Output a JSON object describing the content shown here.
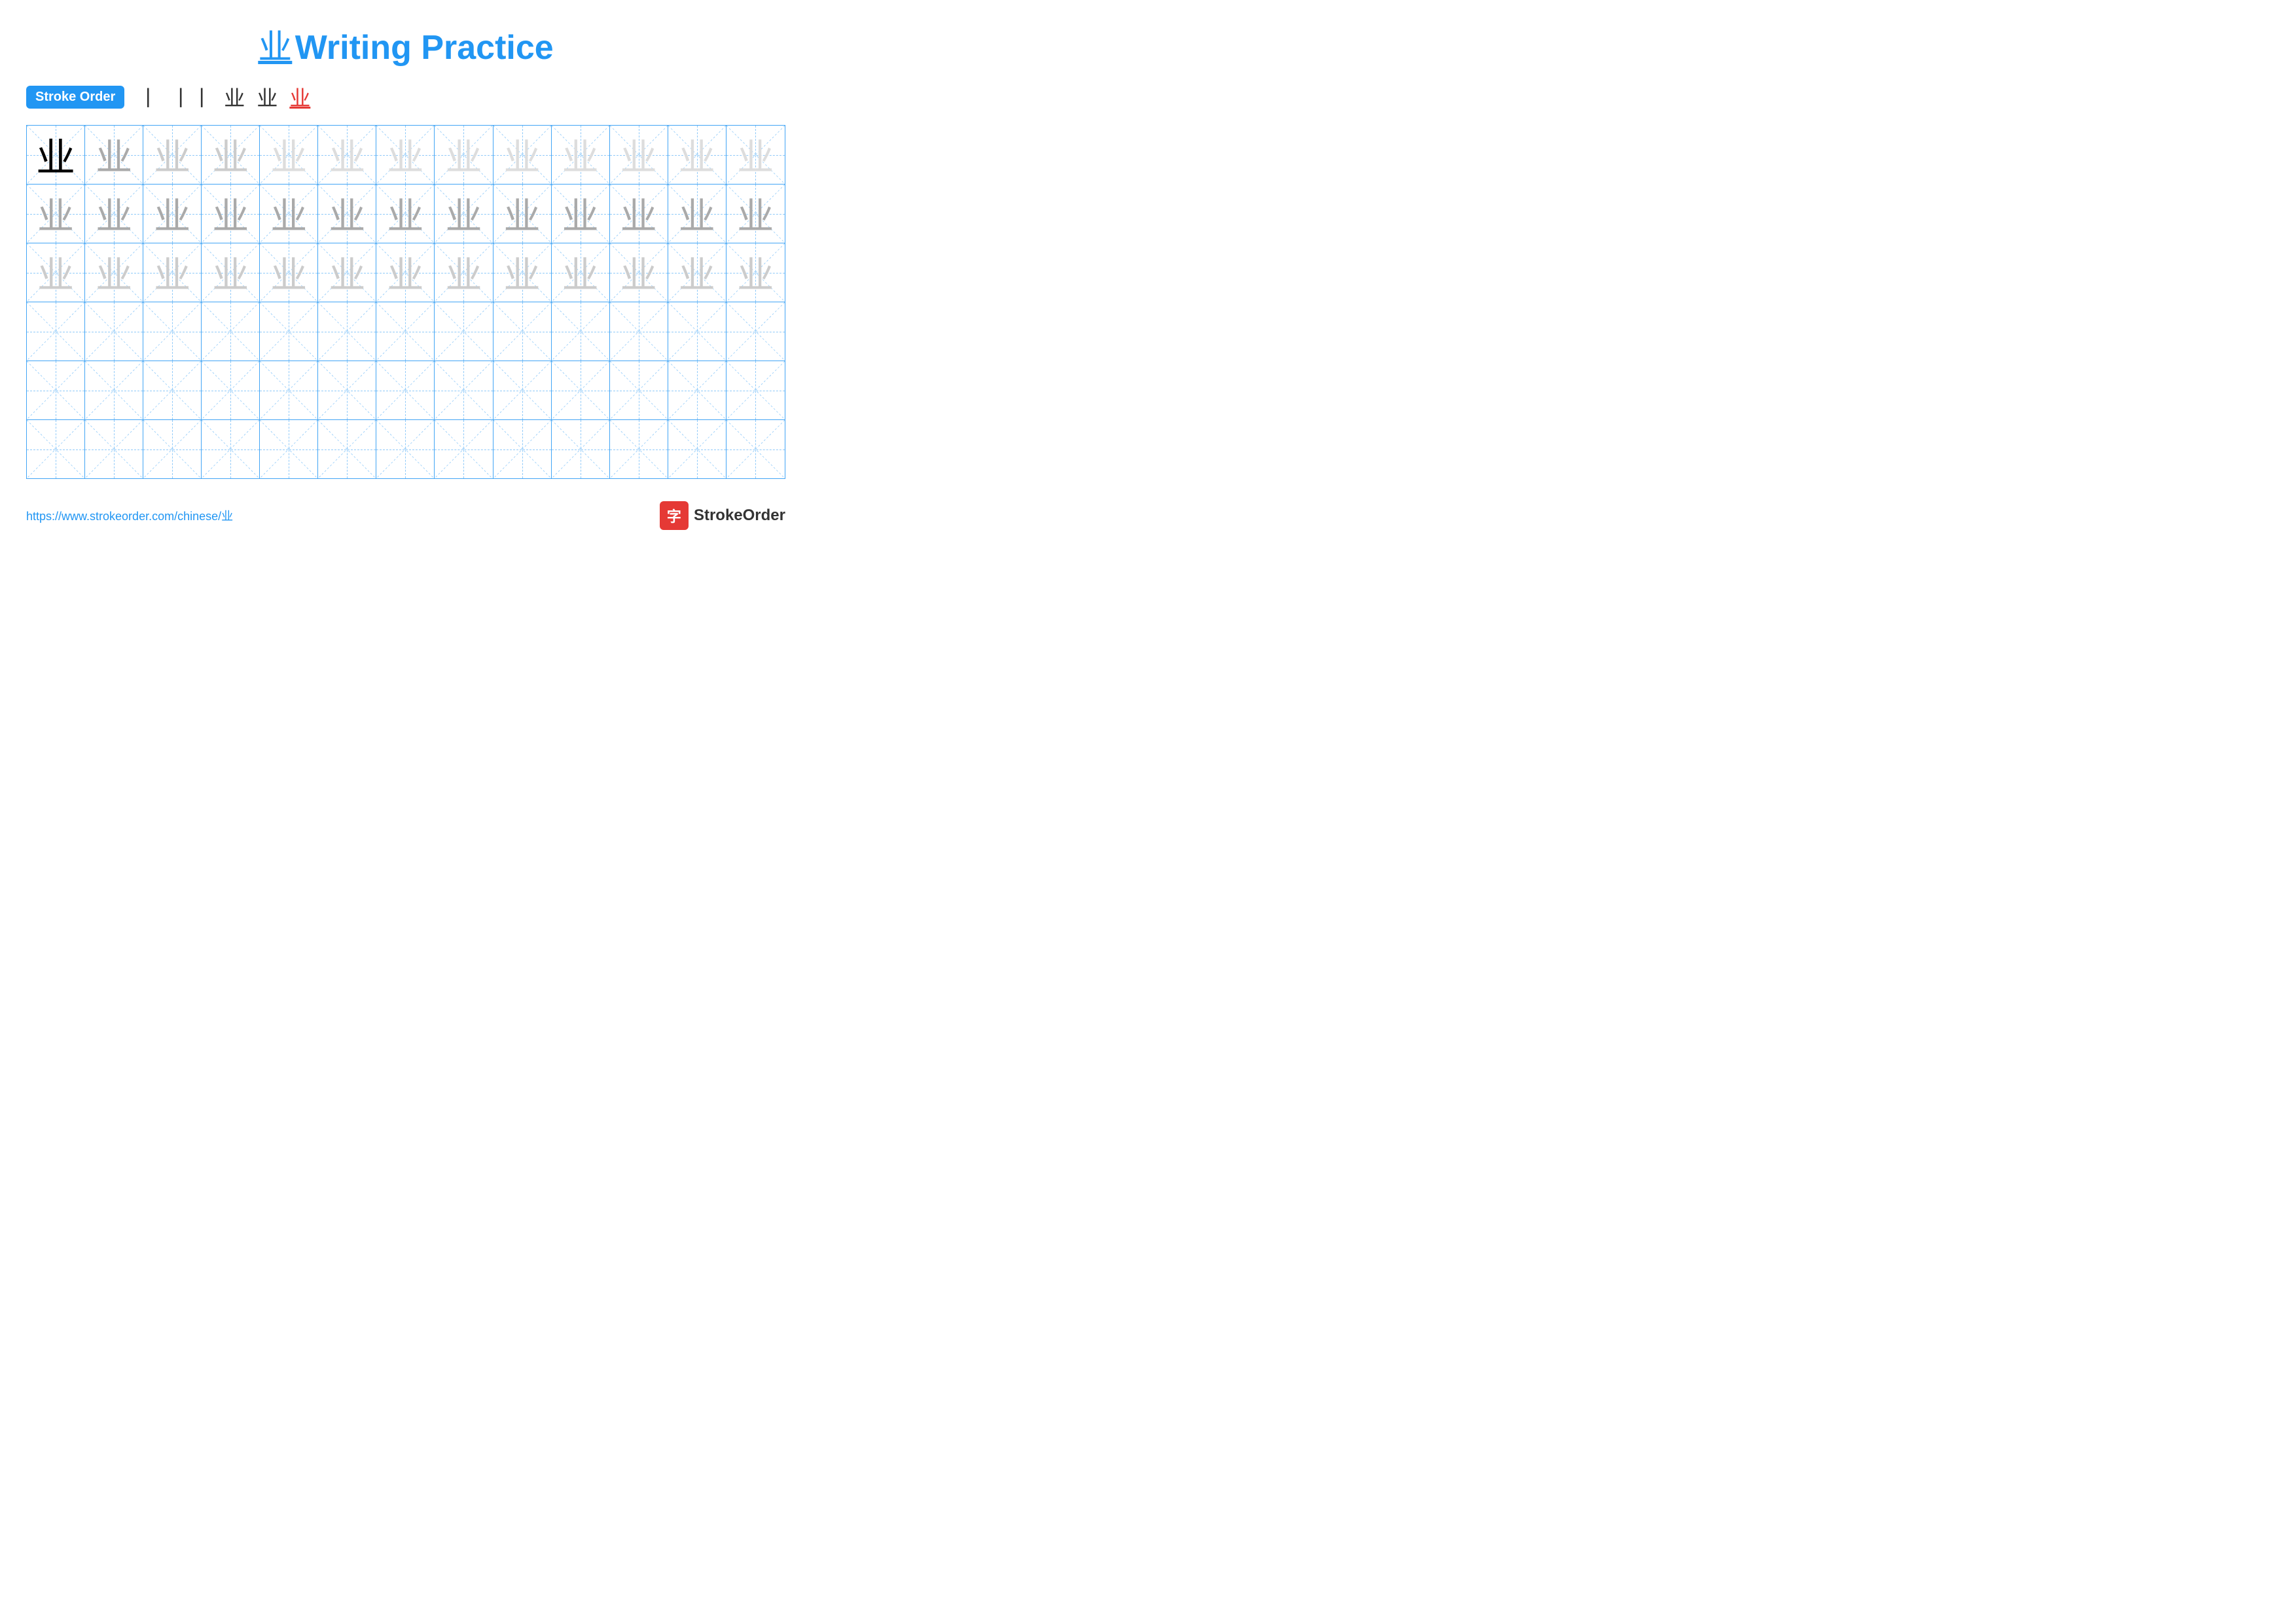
{
  "title": {
    "chinese_char": "业",
    "writing_practice_label": "Writing Practice"
  },
  "stroke_order": {
    "badge_label": "Stroke Order",
    "steps": [
      "丨",
      "丨丨",
      "业",
      "业",
      "业"
    ]
  },
  "grid": {
    "rows": 6,
    "cols": 13,
    "char": "业"
  },
  "footer": {
    "url": "https://www.strokeorder.com/chinese/业",
    "logo_char": "字",
    "logo_text": "StrokeOrder"
  },
  "colors": {
    "blue": "#2196F3",
    "red": "#e53935",
    "grid_border": "#42A5F5",
    "guide_dashed": "#90CAF9"
  }
}
